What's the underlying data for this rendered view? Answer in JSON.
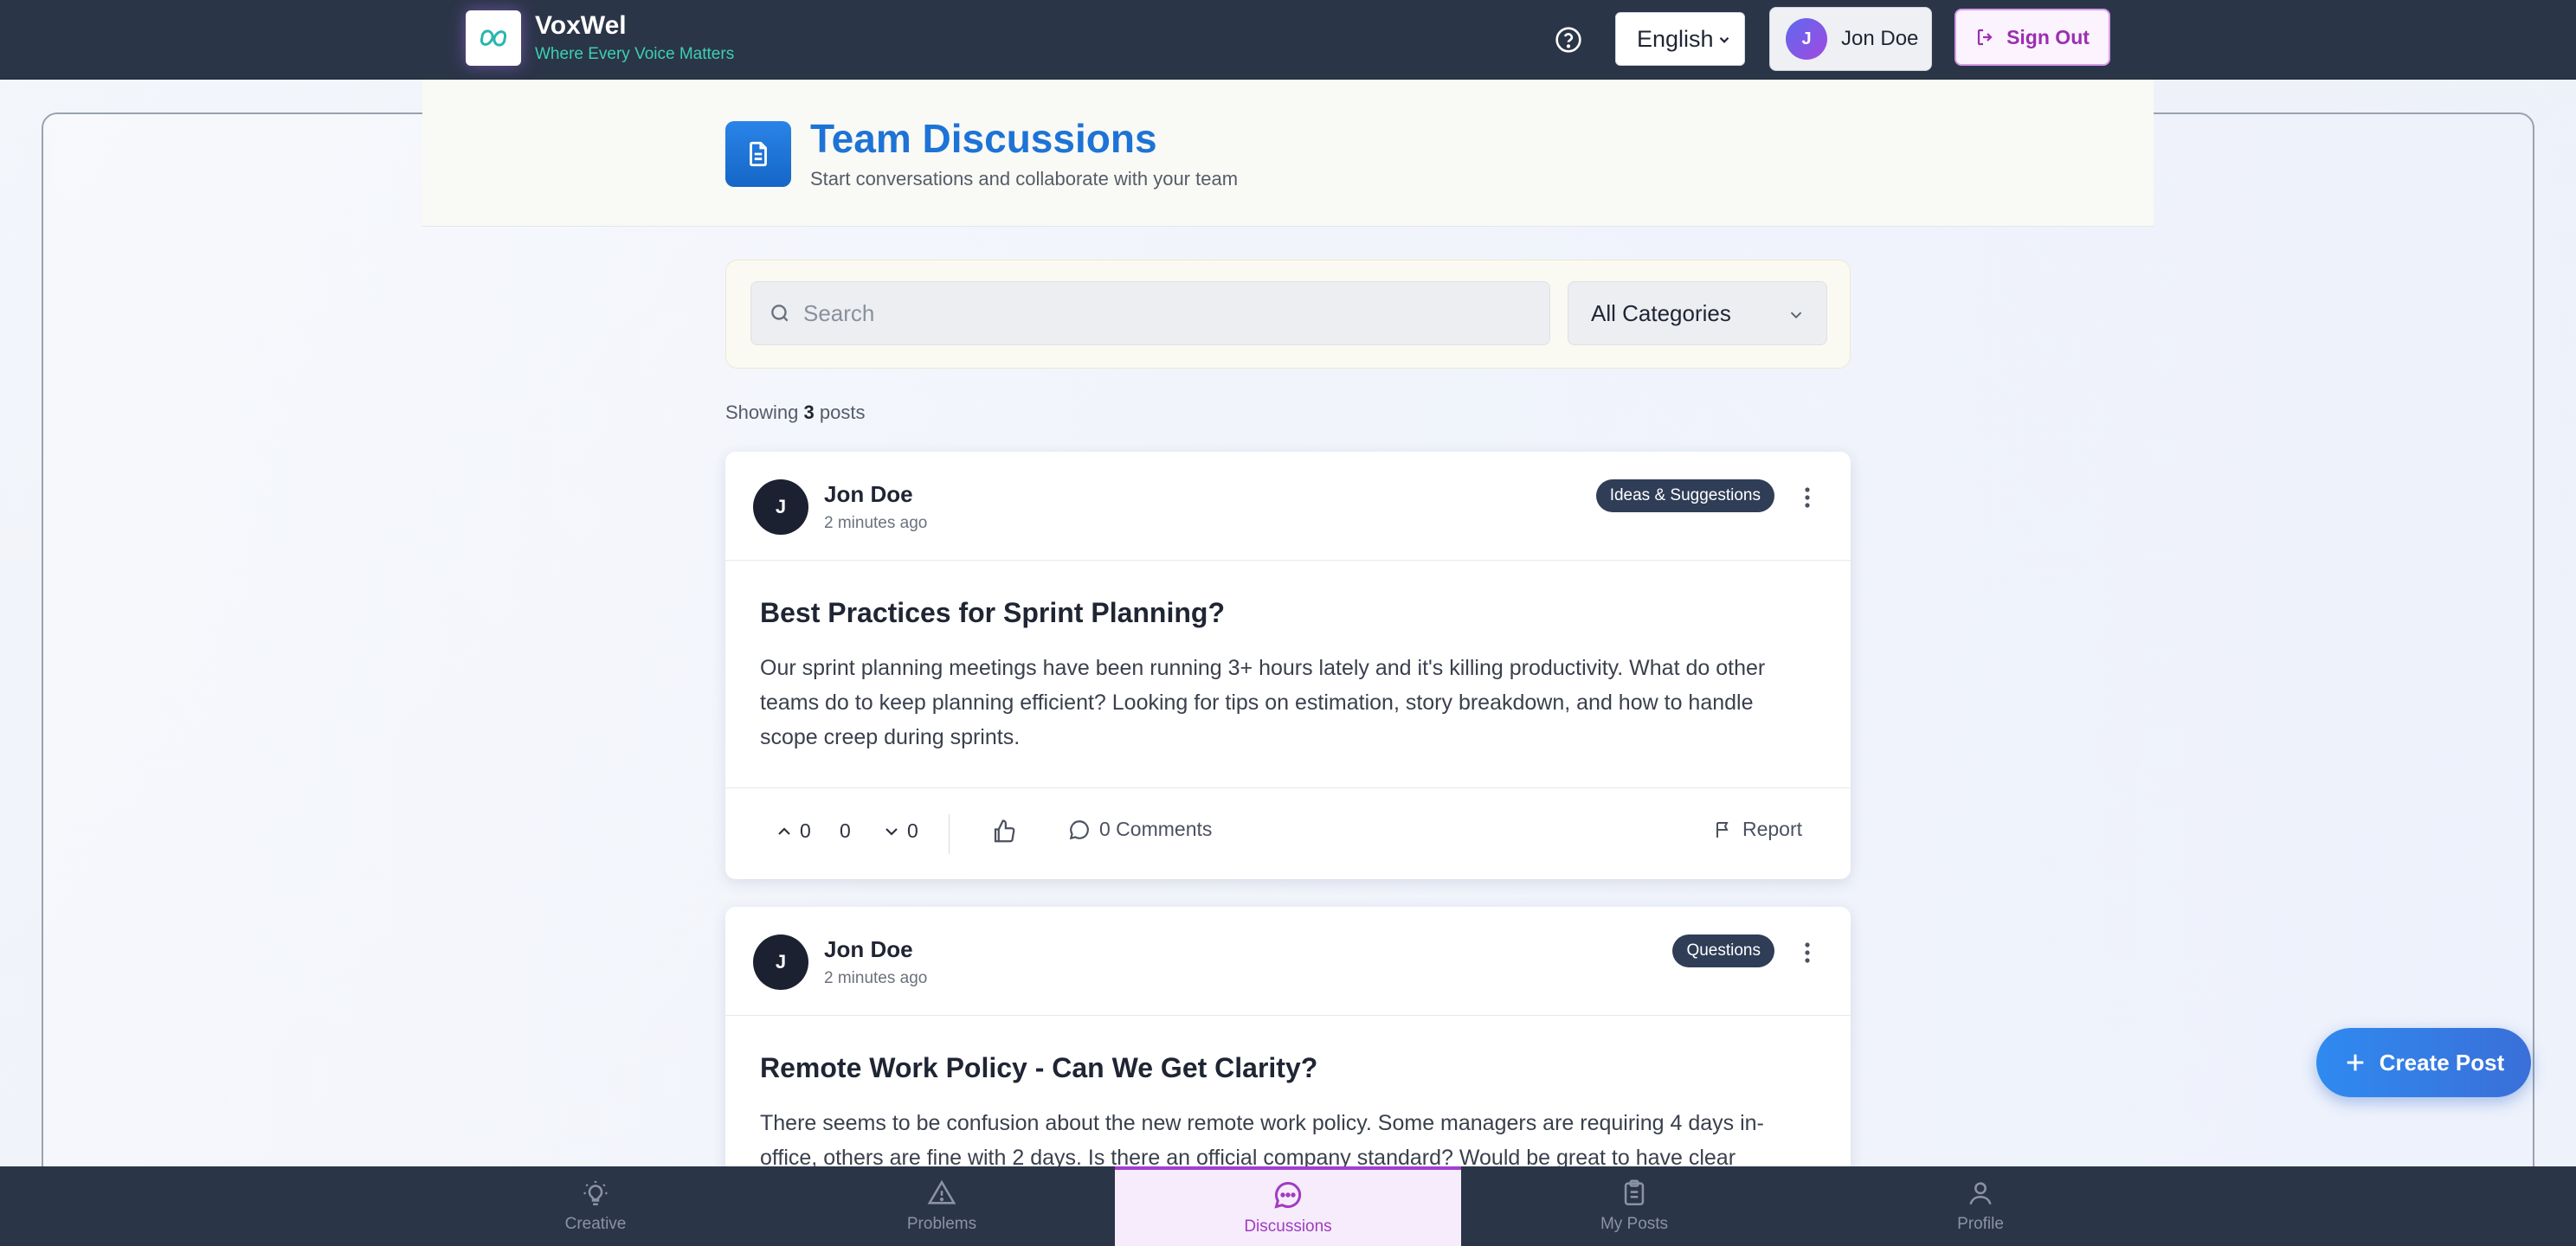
{
  "header": {
    "app_name": "VoxWel",
    "tagline": "Where Every Voice Matters",
    "help_icon": "help-circle-icon",
    "language": "English",
    "user_initial": "J",
    "user_name": "Jon Doe",
    "sign_out_label": "Sign Out"
  },
  "page": {
    "title": "Team Discussions",
    "subtitle": "Start conversations and collaborate with your team"
  },
  "filters": {
    "search_placeholder": "Search",
    "search_value": "",
    "category": "All Categories"
  },
  "results": {
    "prefix": "Showing",
    "count": "3",
    "suffix": "posts"
  },
  "posts": [
    {
      "author_initial": "J",
      "author": "Jon Doe",
      "time": "2 minutes ago",
      "category": "Ideas & Suggestions",
      "title": "Best Practices for Sprint Planning?",
      "body": "Our sprint planning meetings have been running 3+ hours lately and it's killing productivity. What do other teams do to keep planning efficient? Looking for tips on estimation, story breakdown, and how to handle scope creep during sprints.",
      "upvotes": "0",
      "score": "0",
      "downvotes": "0",
      "comments": "0 Comments",
      "report": "Report"
    },
    {
      "author_initial": "J",
      "author": "Jon Doe",
      "time": "2 minutes ago",
      "category": "Questions",
      "title": "Remote Work Policy - Can We Get Clarity?",
      "body": "There seems to be confusion about the new remote work policy. Some managers are requiring 4 days in-office, others are fine with 2 days. Is there an official company standard? Would be great to have clear"
    }
  ],
  "fab": {
    "label": "Create Post"
  },
  "bottom_nav": [
    {
      "label": "Creative",
      "icon": "lightbulb-icon"
    },
    {
      "label": "Problems",
      "icon": "warning-triangle-icon"
    },
    {
      "label": "Discussions",
      "icon": "chat-bubble-icon",
      "active": true
    },
    {
      "label": "My Posts",
      "icon": "clipboard-icon"
    },
    {
      "label": "Profile",
      "icon": "user-icon"
    }
  ],
  "colors": {
    "header_bg": "#2b3548",
    "accent_blue": "#1d73d6",
    "accent_purple": "#a03cc0",
    "badge_bg": "#2f3d57",
    "tagline": "#3ccfb4"
  }
}
